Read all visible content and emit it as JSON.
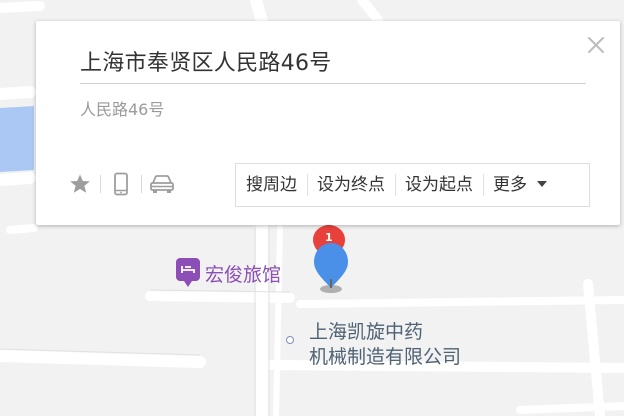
{
  "place": {
    "title": "上海市奉贤区人民路46号",
    "address": "人民路46号"
  },
  "toolbar": {
    "icons": [
      "star-icon",
      "phone-icon",
      "car-icon"
    ]
  },
  "actions": {
    "nearby": "搜周边",
    "set_destination": "设为终点",
    "set_origin": "设为起点",
    "more": "更多"
  },
  "map": {
    "marker_badge": "1",
    "pois": {
      "hotel": "宏俊旅馆",
      "company_line1": "上海凯旋中药",
      "company_line2": "机械制造有限公司"
    },
    "colors": {
      "background": "#f2f2f2",
      "road": "#ffffff",
      "water": "#abc8f5",
      "marker_blue": "#4a90e8",
      "marker_red": "#e8413c",
      "poi_purple": "#8b4fb5"
    }
  }
}
